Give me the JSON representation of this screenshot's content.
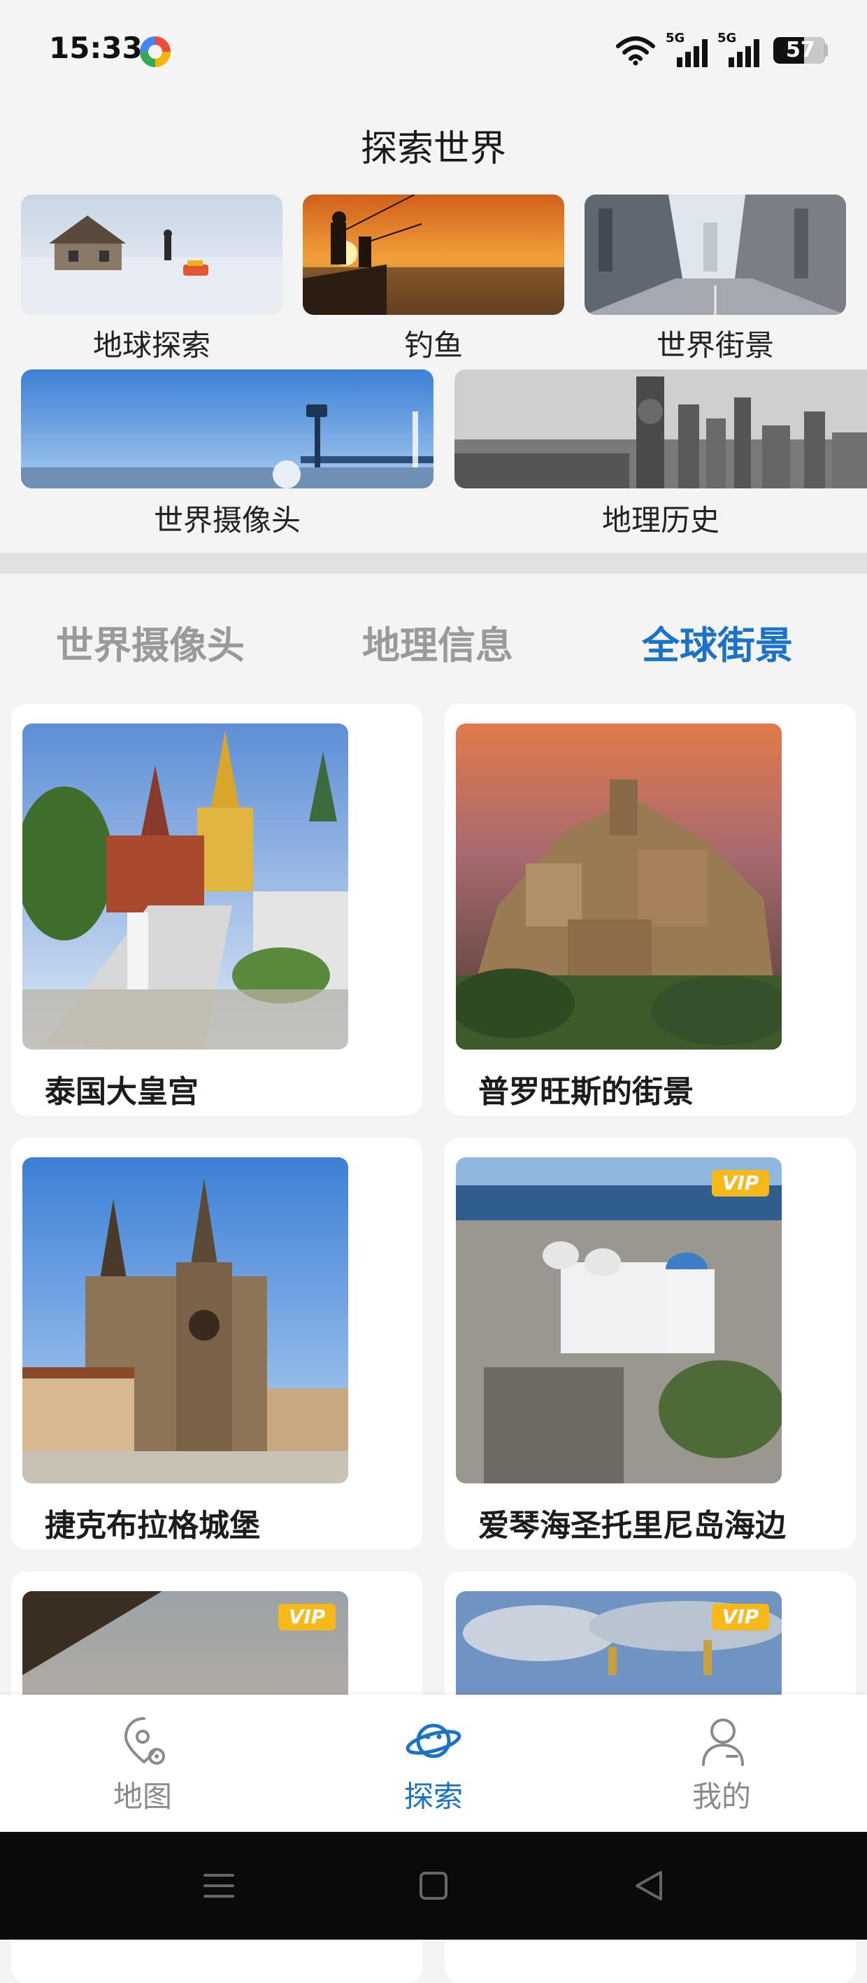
{
  "status_bar": {
    "time": "15:33",
    "signal_1_label": "5G",
    "signal_2_label": "5G",
    "battery": "57"
  },
  "explore": {
    "title": "探索世界",
    "tiles": [
      {
        "label": "地球探索",
        "icon": "polar-cabin-photo"
      },
      {
        "label": "钓鱼",
        "icon": "sunset-fishing-photo"
      },
      {
        "label": "世界街景",
        "icon": "city-street-photo"
      },
      {
        "label": "世界摄像头",
        "icon": "webcam-sky-photo"
      },
      {
        "label": "地理历史",
        "icon": "old-city-skyline-photo"
      }
    ]
  },
  "tabs": [
    {
      "label": "世界摄像头",
      "active": false
    },
    {
      "label": "地理信息",
      "active": false
    },
    {
      "label": "全球街景",
      "active": true
    }
  ],
  "cards": [
    {
      "title": "泰国大皇宫",
      "vip": false,
      "photo": "grand-palace-photo"
    },
    {
      "title": "普罗旺斯的街景",
      "vip": false,
      "photo": "provence-village-photo"
    },
    {
      "title": "捷克布拉格城堡",
      "vip": false,
      "photo": "prague-castle-photo"
    },
    {
      "title": "爱琴海圣托里尼岛海边",
      "vip": true,
      "vip_label": "VIP",
      "photo": "santorini-photo"
    },
    {
      "title": "",
      "vip": true,
      "vip_label": "VIP",
      "photo": "sunset-sky-photo"
    },
    {
      "title": "",
      "vip": true,
      "vip_label": "VIP",
      "photo": "domes-sky-photo"
    }
  ],
  "bottom_nav": [
    {
      "label": "地图",
      "icon": "map-pin-icon",
      "active": false
    },
    {
      "label": "探索",
      "icon": "planet-icon",
      "active": true
    },
    {
      "label": "我的",
      "icon": "user-icon",
      "active": false
    }
  ],
  "colors": {
    "accent": "#1a73c7",
    "vip": "#f6b81b",
    "background": "#f4f4f4",
    "inactive_tab": "#9a9a9a"
  }
}
